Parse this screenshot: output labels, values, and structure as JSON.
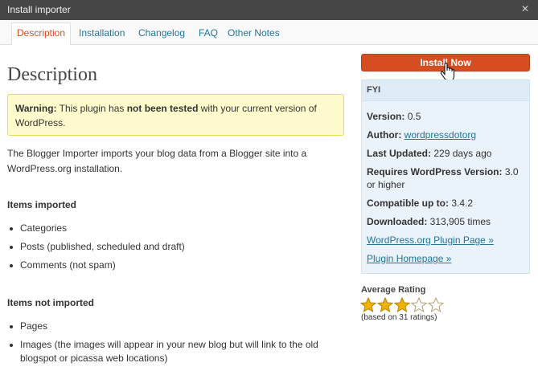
{
  "window": {
    "title": "Install importer",
    "close_icon": "close-icon"
  },
  "tabs": [
    {
      "label": "Description",
      "active": true
    },
    {
      "label": "Installation",
      "active": false
    },
    {
      "label": "Changelog",
      "active": false
    },
    {
      "label": "FAQ",
      "active": false
    },
    {
      "label": "Other Notes",
      "active": false
    }
  ],
  "main": {
    "heading": "Description",
    "warning": {
      "prefix": "Warning:",
      "text_1": " This plugin has ",
      "emphasis": "not been tested",
      "text_2": " with your current version of WordPress."
    },
    "intro": "The Blogger Importer imports your blog data from a Blogger site into a WordPress.org installation.",
    "imported": {
      "heading": "Items imported",
      "items": [
        "Categories",
        "Posts (published, scheduled and draft)",
        "Comments (not spam)"
      ]
    },
    "not_imported": {
      "heading": "Items not imported",
      "items": [
        "Pages",
        "Images (the images will appear in your new blog but will link to the old blogspot or picassa web locations)"
      ]
    }
  },
  "sidebar": {
    "install_button": "Install Now",
    "fyi": {
      "heading": "FYI",
      "version_label": "Version:",
      "version": "0.5",
      "author_label": "Author:",
      "author": "wordpressdotorg",
      "updated_label": "Last Updated:",
      "updated": "229 days ago",
      "requires_label": "Requires WordPress Version:",
      "requires": "3.0 or higher",
      "compatible_label": "Compatible up to:",
      "compatible": "3.4.2",
      "downloaded_label": "Downloaded:",
      "downloaded": "313,905 times",
      "plugin_page_link": "WordPress.org Plugin Page »",
      "homepage_link": "Plugin Homepage »"
    },
    "rating": {
      "title": "Average Rating",
      "stars": 3,
      "max_stars": 5,
      "count_text": "(based on 31 ratings)"
    }
  },
  "colors": {
    "accent": "#d54e21",
    "link": "#21759b",
    "star": "#f0b200"
  }
}
